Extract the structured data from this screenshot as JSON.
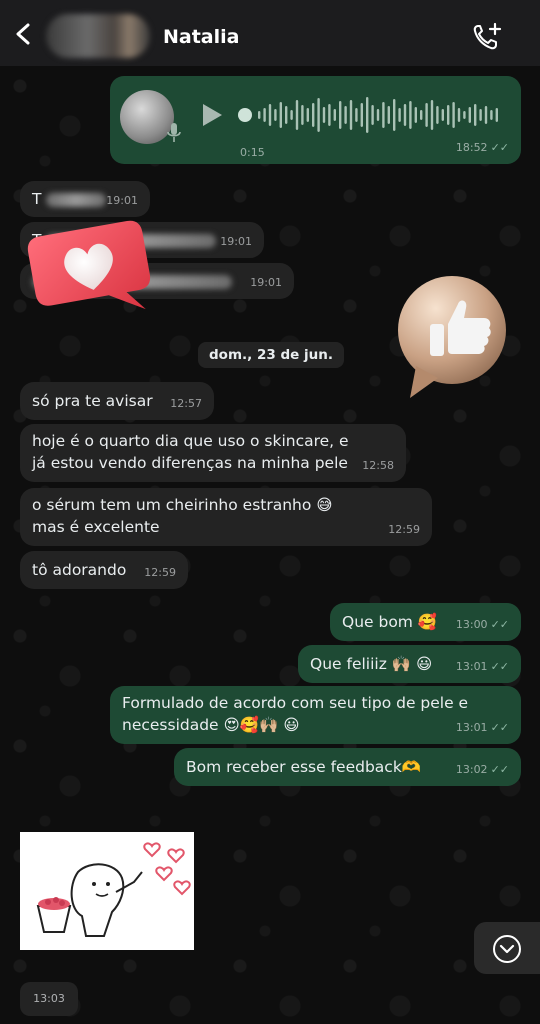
{
  "header": {
    "contact_name": "Natalia",
    "back_icon": "chevron-left-icon",
    "call_icon": "phone-add-icon"
  },
  "voice_message": {
    "duration": "0:15",
    "time": "18:52",
    "status": "✓✓"
  },
  "redacted_messages": [
    {
      "time": "19:01",
      "visible_prefix": "T"
    },
    {
      "time": "19:01",
      "visible_prefix": "T"
    },
    {
      "time": "19:01",
      "visible_prefix": ""
    }
  ],
  "date_separator": "dom., 23 de jun.",
  "messages_in": [
    {
      "text": "só pra te avisar",
      "time": "12:57"
    },
    {
      "text": "hoje é o quarto dia que uso o skincare, e já estou vendo diferenças na minha pele",
      "time": "12:58"
    },
    {
      "text": "o sérum tem um cheirinho estranho 😅 mas é excelente",
      "time": "12:59"
    },
    {
      "text": "tô adorando",
      "time": "12:59"
    }
  ],
  "messages_out": [
    {
      "text": "Que bom 🥰",
      "time": "13:00",
      "status": "✓✓"
    },
    {
      "text": "Que feliiiz 🙌🏼 😃",
      "time": "13:01",
      "status": "✓✓"
    },
    {
      "text": "Formulado de acordo com seu tipo de pele e necessidade 😍🥰🙌🏼 😃",
      "time": "13:01",
      "status": "✓✓"
    },
    {
      "text": "Bom receber esse feedback🫶",
      "time": "13:02",
      "status": "✓✓"
    }
  ],
  "sticker_message": {
    "time": "13:03"
  },
  "colors": {
    "incoming_bubble": "#232323",
    "outgoing_bubble": "#1e4a34",
    "header_bg": "#1c1c1e"
  }
}
